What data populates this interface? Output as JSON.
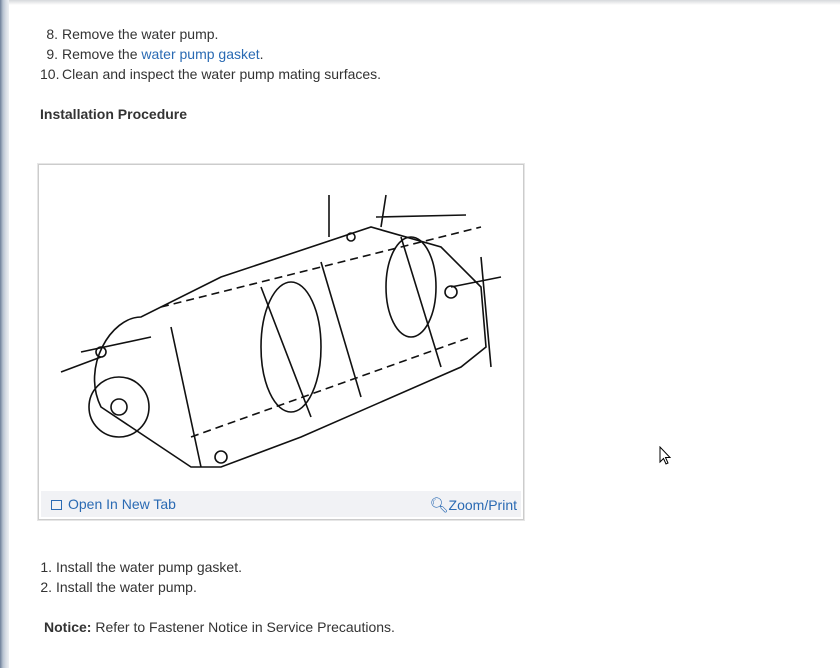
{
  "removal_steps": [
    {
      "num": "8.",
      "pre": "Remove the water pump.",
      "link": "",
      "post": ""
    },
    {
      "num": "9.",
      "pre": "Remove the ",
      "link": "water pump gasket",
      "post": "."
    },
    {
      "num": "10.",
      "pre": "Clean and inspect the water pump mating surfaces.",
      "link": "",
      "post": ""
    }
  ],
  "installation_heading": "Installation Procedure",
  "figure": {
    "open_new_tab": "Open In New Tab",
    "zoom_print": "Zoom/Print"
  },
  "install_steps": [
    {
      "num": "1.",
      "text": "Install the water pump gasket."
    },
    {
      "num": "2.",
      "text": "Install the water pump."
    }
  ],
  "notice": {
    "label": "Notice:",
    "text": " Refer to Fastener Notice in Service Precautions."
  }
}
